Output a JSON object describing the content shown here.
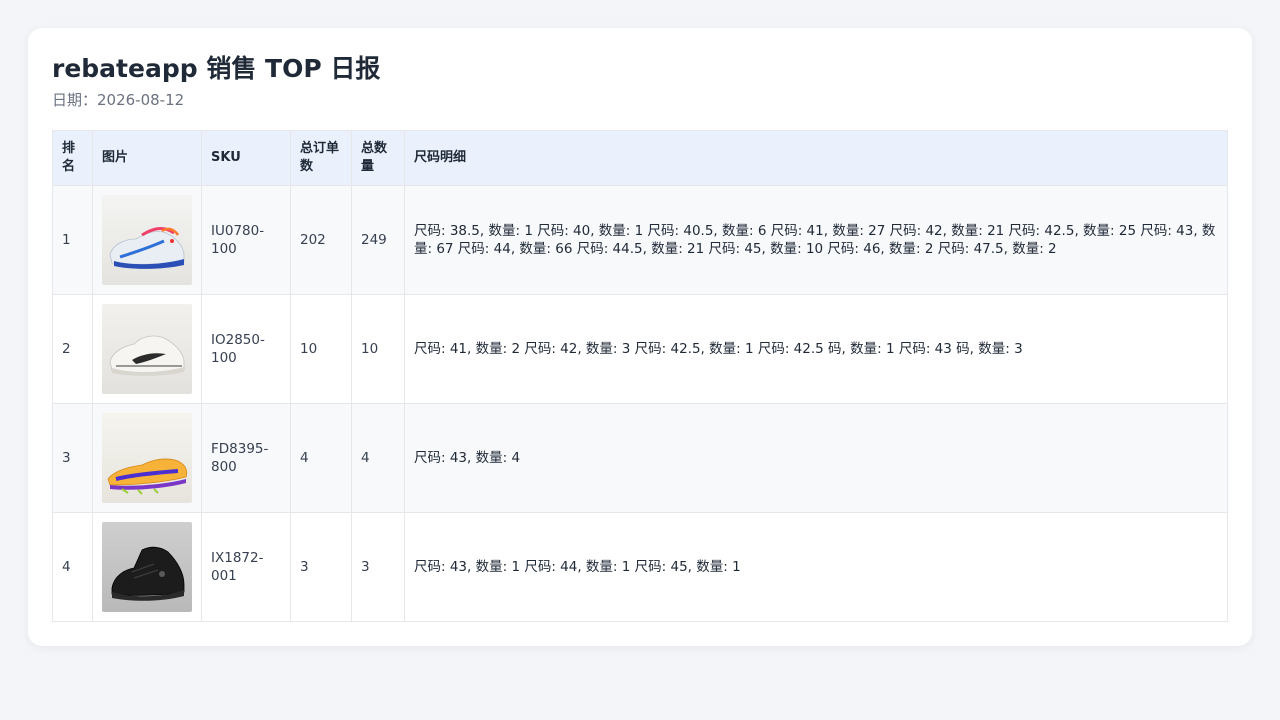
{
  "report": {
    "title": "rebateapp 销售 TOP 日报",
    "date_label": "日期：2026-08-12"
  },
  "table": {
    "headers": {
      "rank": "排名",
      "image": "图片",
      "sku": "SKU",
      "orders": "总订单数",
      "qty": "总数量",
      "sizes": "尺码明细"
    },
    "rows": [
      {
        "rank": "1",
        "image_icon": "sneaker-white-blue-red-icon",
        "sku": "IU0780-100",
        "orders": "202",
        "qty": "249",
        "sizes": "尺码: 38.5, 数量: 1 尺码: 40, 数量: 1 尺码: 40.5, 数量: 6 尺码: 41, 数量: 27 尺码: 42, 数量: 21 尺码: 42.5, 数量: 25 尺码: 43, 数量: 67 尺码: 44, 数量: 66 尺码: 44.5, 数量: 21 尺码: 45, 数量: 10 尺码: 46, 数量: 2 尺码: 47.5, 数量: 2"
      },
      {
        "rank": "2",
        "image_icon": "sneaker-white-black-icon",
        "sku": "IO2850-100",
        "orders": "10",
        "qty": "10",
        "sizes": "尺码: 41, 数量: 2 尺码: 42, 数量: 3 尺码: 42.5, 数量: 1 尺码: 42.5 码, 数量: 1 尺码: 43 码, 数量: 3"
      },
      {
        "rank": "3",
        "image_icon": "spike-orange-purple-icon",
        "sku": "FD8395-800",
        "orders": "4",
        "qty": "4",
        "sizes": "尺码: 43, 数量: 4"
      },
      {
        "rank": "4",
        "image_icon": "sneaker-black-high-icon",
        "sku": "IX1872-001",
        "orders": "3",
        "qty": "3",
        "sizes": "尺码: 43, 数量: 1 尺码: 44, 数量: 1 尺码: 45, 数量: 1"
      }
    ]
  }
}
